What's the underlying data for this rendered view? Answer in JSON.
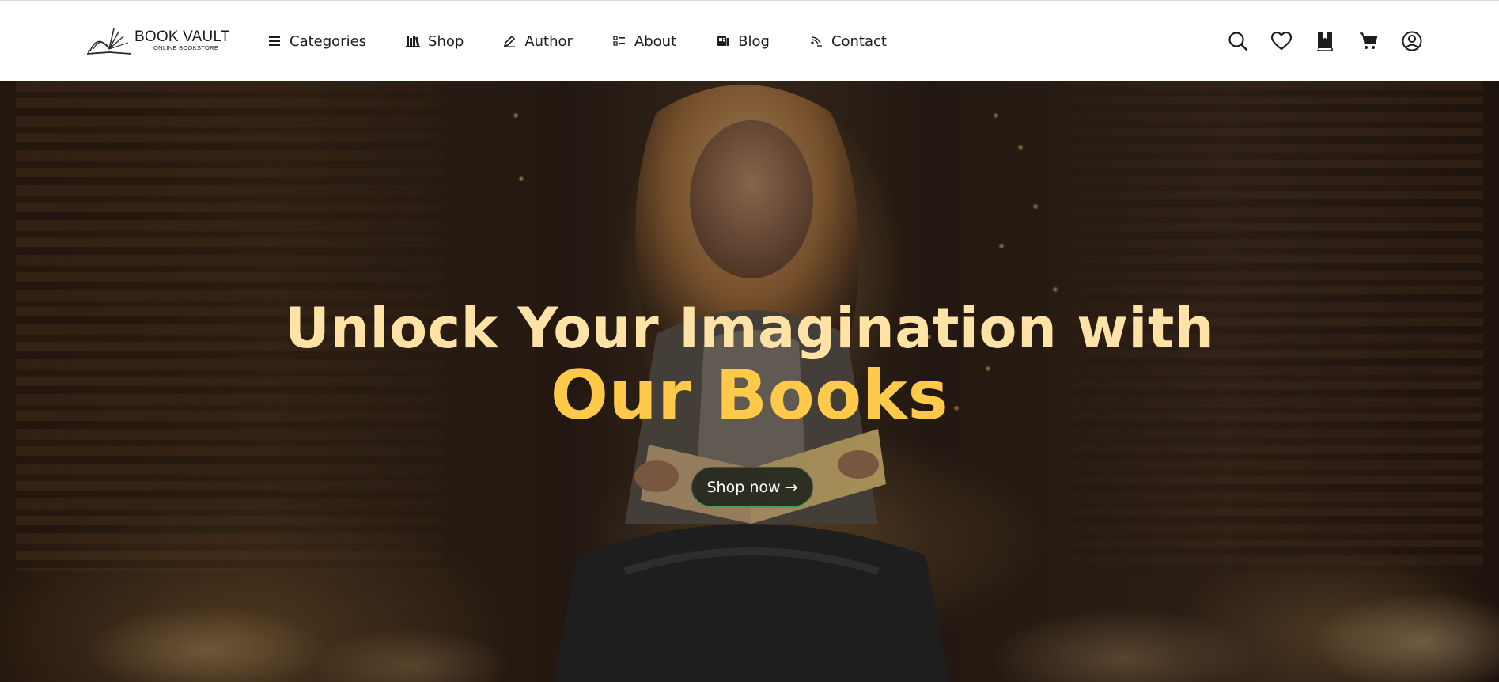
{
  "logo": {
    "title": "BOOK VAULT",
    "subtitle": "ONLINE BOOKSTORE",
    "icon": "open-book-logo"
  },
  "nav": {
    "items": [
      {
        "label": "Categories",
        "icon": "menu-lines-icon"
      },
      {
        "label": "Shop",
        "icon": "books-shelf-icon"
      },
      {
        "label": "Author",
        "icon": "pen-edit-icon"
      },
      {
        "label": "About",
        "icon": "list-icon"
      },
      {
        "label": "Blog",
        "icon": "book-blog-icon"
      },
      {
        "label": "Contact",
        "icon": "contact-signal-icon"
      }
    ]
  },
  "actions": [
    {
      "icon": "search-icon"
    },
    {
      "icon": "heart-icon"
    },
    {
      "icon": "bookmark-book-icon"
    },
    {
      "icon": "cart-icon"
    },
    {
      "icon": "user-circle-icon"
    }
  ],
  "hero": {
    "headline_line1": "Unlock Your Imagination with",
    "headline_line2": "Our Books",
    "cta_label": "Shop now →"
  },
  "colors": {
    "headline_line1": "#ffe3a6",
    "headline_line2": "#ffc94a",
    "cta_accent": "#3fa35a",
    "nav_bg": "#ffffff",
    "nav_text": "#1d1d1d"
  }
}
